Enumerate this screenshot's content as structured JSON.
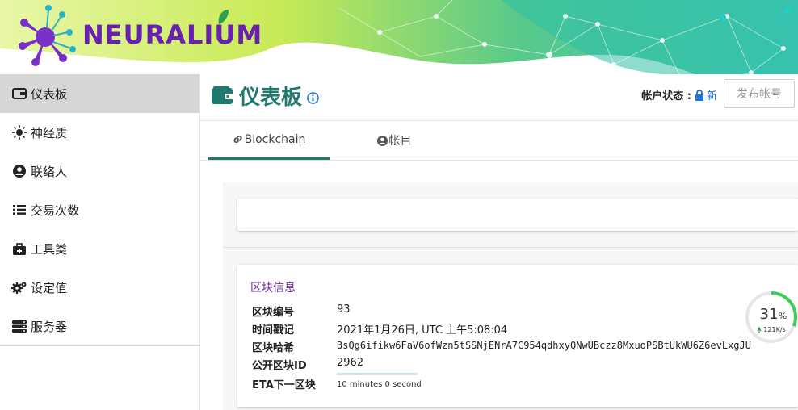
{
  "app": {
    "logo_text": "NEURALIUM"
  },
  "sidebar": {
    "items": [
      {
        "label": "仪表板",
        "icon": "wallet-icon",
        "active": true
      },
      {
        "label": "神经质",
        "icon": "sun-icon",
        "active": false
      },
      {
        "label": "联络人",
        "icon": "user-circle-icon",
        "active": false
      },
      {
        "label": "交易次数",
        "icon": "list-icon",
        "active": false
      },
      {
        "label": "工具类",
        "icon": "toolbox-icon",
        "active": false
      },
      {
        "label": "设定值",
        "icon": "cogs-icon",
        "active": false
      },
      {
        "label": "服务器",
        "icon": "server-icon",
        "active": false
      }
    ]
  },
  "header": {
    "title": "仪表板",
    "account_status_label": "帐户状态 :",
    "account_status_value": "新",
    "publish_button": "发布帐号"
  },
  "tabs": [
    {
      "label": "Blockchain",
      "icon": "link-icon",
      "active": true
    },
    {
      "label": "帐目",
      "icon": "user-circle-icon",
      "active": false
    }
  ],
  "block_info": {
    "title": "区块信息",
    "rows": [
      {
        "label": "区块编号",
        "value": "93"
      },
      {
        "label": "时间戳记",
        "value": "2021年1月26日, UTC 上午5:08:04"
      },
      {
        "label": "区块哈希",
        "value": "3sQg6ifikw6FaV6ofWzn5tSSNjENrA7C954qdhxyQNwUBczz8MxuoPSBtUkWU6Z6evLxgJU"
      },
      {
        "label": "公开区块ID",
        "value": "2962"
      },
      {
        "label": "ETA下一区块",
        "value": "10 minutes 0 second"
      }
    ],
    "eta_progress": 0.0
  },
  "sync_widget": {
    "percent_value": "31",
    "percent_sign": "%",
    "speed": "121K/s",
    "progress": 0.31
  },
  "colors": {
    "accent": "#1e7a6e",
    "logo": "#6a1fb3",
    "link": "#1a73d9",
    "card_title": "#6a2c91",
    "progress_ring": "#3ccf5a"
  }
}
